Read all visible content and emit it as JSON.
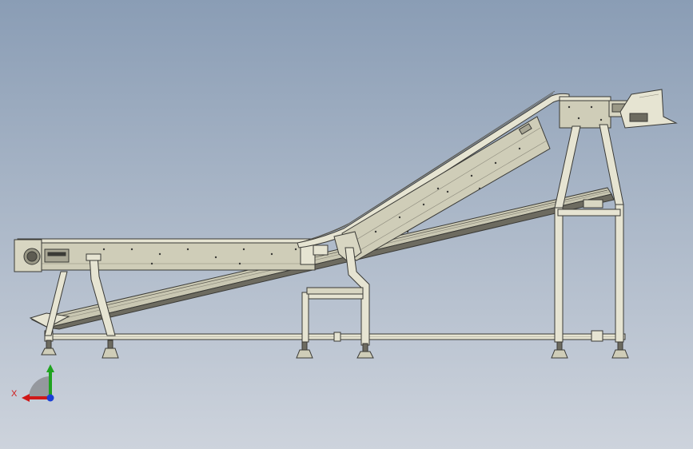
{
  "viewport": {
    "background_top": "#8a9db5",
    "background_bottom": "#cdd3dc"
  },
  "model": {
    "body_color": "#cfcdb8",
    "frame_color": "#e6e4d2",
    "edge_color": "#3a3a36",
    "dark_color": "#6d6b60"
  },
  "triad": {
    "x_label": "X",
    "x_color": "#d01818",
    "y_color": "#1fa31f",
    "z_color": "#1a3fd6"
  }
}
